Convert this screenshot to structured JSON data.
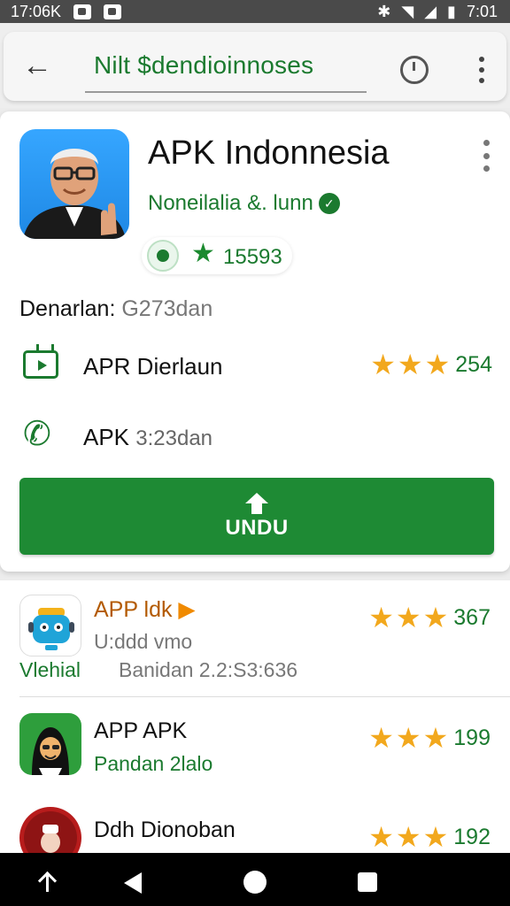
{
  "status_bar": {
    "time_left": "17:06K",
    "time_right": "7:01"
  },
  "search": {
    "query": "Nilt $dendioinnoses"
  },
  "app": {
    "title": "APK Indonnesia",
    "developer": "Noneilalia  &. lunn",
    "rating_count": "15593",
    "download_label": "Denarlan:",
    "download_value": "G273dan",
    "info_rows": [
      {
        "icon": "tv-icon",
        "label": "APR Dierlaun",
        "muted": "",
        "rating": "254"
      },
      {
        "icon": "phone-icon",
        "label": "APK",
        "muted": "3:23dan",
        "rating": ""
      }
    ],
    "install_button": "UNDU"
  },
  "list": [
    {
      "title": "APP ldk",
      "subtitle": "U:ddd vmo",
      "extra_left": "Vlehial",
      "extra_right": "Banidan 2.2:S3:636",
      "rating": "367"
    },
    {
      "title": "APP APK",
      "subtitle": "Pandan 2lalo",
      "rating": "199"
    },
    {
      "title": "Ddh Dionoban",
      "subtitle": "",
      "rating": "192"
    }
  ],
  "colors": {
    "accent_green": "#1e8a34",
    "star": "#f2a81d",
    "status_bar": "#4a4a4a"
  }
}
